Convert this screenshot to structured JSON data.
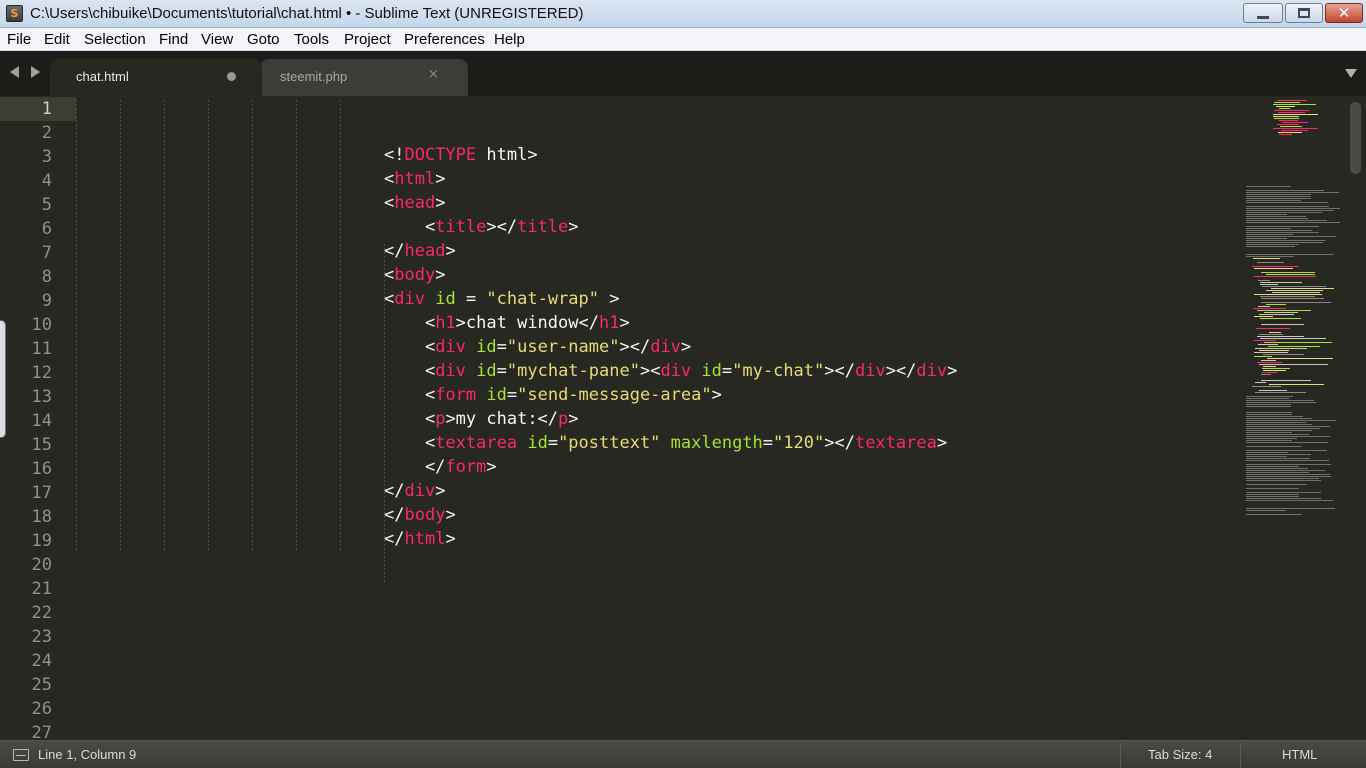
{
  "window": {
    "title": "C:\\Users\\chibuike\\Documents\\tutorial\\chat.html • - Sublime Text (UNREGISTERED)",
    "app_icon": "sublime-text-icon",
    "app_icon_glyph": "S",
    "controls": {
      "close_glyph": "✕"
    }
  },
  "menu": [
    "File",
    "Edit",
    "Selection",
    "Find",
    "View",
    "Goto",
    "Tools",
    "Project",
    "Preferences",
    "Help"
  ],
  "tabs": [
    {
      "label": "chat.html",
      "active": true,
      "modified": true
    },
    {
      "label": "steemit.php",
      "active": false,
      "close_glyph": "×"
    }
  ],
  "editor": {
    "line_numbers": [
      "1",
      "2",
      "3",
      "4",
      "5",
      "6",
      "7",
      "8",
      "9",
      "10",
      "11",
      "12",
      "13",
      "14",
      "15",
      "16",
      "17",
      "18",
      "19",
      "20",
      "21",
      "22",
      "23",
      "24",
      "25",
      "26",
      "27"
    ],
    "current_line": 1,
    "colors": {
      "tag": "#f92672",
      "attribute": "#a6e22e",
      "string": "#e6db74",
      "text": "#f8f8f2",
      "background": "#272822"
    }
  },
  "code": {
    "l3": [
      "<!",
      "DOCTYPE",
      " html>"
    ],
    "l4": [
      "<",
      "html",
      ">"
    ],
    "l5": [
      "<",
      "head",
      ">"
    ],
    "l6": [
      "    <",
      "title",
      "></",
      "title",
      ">"
    ],
    "l7": [
      "</",
      "head",
      ">"
    ],
    "l8": [
      "<",
      "body",
      ">"
    ],
    "l9": [
      "<",
      "div",
      " ",
      "id",
      " = ",
      "\"chat-wrap\"",
      " >"
    ],
    "l10": [
      "    <",
      "h1",
      ">chat window</",
      "h1",
      ">"
    ],
    "l11": [
      "    <",
      "div",
      " ",
      "id",
      "=",
      "\"user-name\"",
      "></",
      "div",
      ">"
    ],
    "l12": [
      "    <",
      "div",
      " ",
      "id",
      "=",
      "\"mychat-pane\"",
      "><",
      "div",
      " ",
      "id",
      "=",
      "\"my-chat\"",
      "></",
      "div",
      "></",
      "div",
      ">"
    ],
    "l13": [
      "    <",
      "form",
      " ",
      "id",
      "=",
      "\"send-message-area\"",
      ">"
    ],
    "l14": [
      "    <",
      "p",
      ">my chat:</",
      "p",
      ">"
    ],
    "l15": [
      "    <",
      "textarea",
      " ",
      "id",
      "=",
      "\"posttext\"",
      " ",
      "maxlength",
      "=",
      "\"120\"",
      "></",
      "textarea",
      ">"
    ],
    "l16": [
      "    </",
      "form",
      ">"
    ],
    "l17": [
      "</",
      "div",
      ">"
    ],
    "l18": [
      "</",
      "body",
      ">"
    ],
    "l19": [
      "</",
      "html",
      ">"
    ]
  },
  "status": {
    "position": "Line 1, Column 9",
    "tab_size": "Tab Size: 4",
    "syntax": "HTML"
  }
}
